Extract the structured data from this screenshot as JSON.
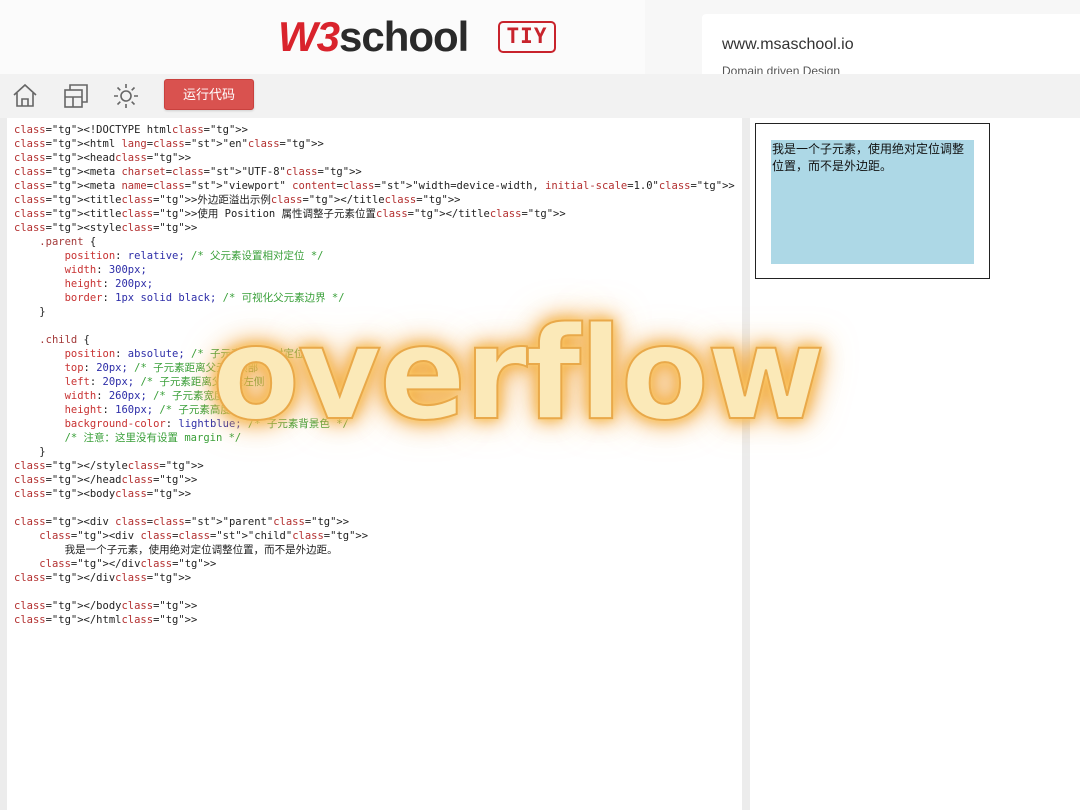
{
  "header": {
    "logo_w3": "W3",
    "logo_school": "school",
    "tiy_badge": "TIY",
    "ad_url": "www.msaschool.io",
    "ad_tagline": "Domain driven Design"
  },
  "toolbar": {
    "icons": [
      "home-icon",
      "layout-icon",
      "theme-sun-icon"
    ],
    "run_label": "运行代码"
  },
  "editor": {
    "lines": [
      "<!DOCTYPE html>",
      "<html lang=\"en\">",
      "<head>",
      "<meta charset=\"UTF-8\">",
      "<meta name=\"viewport\" content=\"width=device-width, initial-scale=1.0\">",
      "<title>外边距溢出示例</title>",
      "<title>使用 Position 属性调整子元素位置</title>",
      "<style>",
      "    .parent {",
      "        position: relative; /* 父元素设置相对定位 */",
      "        width: 300px;",
      "        height: 200px;",
      "        border: 1px solid black; /* 可视化父元素边界 */",
      "    }",
      "",
      "    .child {",
      "        position: absolute; /* 子元素设置绝对定位 */",
      "        top: 20px; /* 子元素距离父元素顶部 */",
      "        left: 20px; /* 子元素距离父元素左侧 */",
      "        width: 260px; /* 子元素宽度 */",
      "        height: 160px; /* 子元素高度 */",
      "        background-color: lightblue; /* 子元素背景色 */",
      "        /* 注意：这里没有设置 margin */",
      "    }",
      "</style>",
      "</head>",
      "<body>",
      "",
      "<div class=\"parent\">",
      "    <div class=\"child\">",
      "        我是一个子元素，使用绝对定位调整位置，而不是外边距。",
      "    </div>",
      "</div>",
      "",
      "</body>",
      "</html>"
    ]
  },
  "preview": {
    "child_text": "我是一个子元素，使用绝对定位调整位置，而不是外边距。"
  },
  "overlay": {
    "text": "overflow"
  },
  "colors": {
    "run_button": "#d9524f",
    "brand_red": "#d9232c",
    "child_bg": "lightblue"
  }
}
